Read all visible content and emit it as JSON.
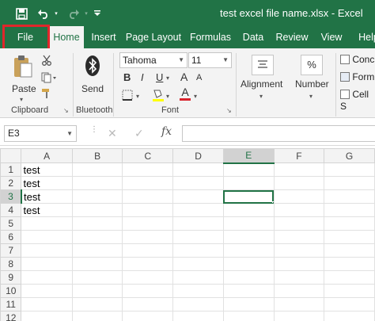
{
  "window": {
    "title": "test excel file name.xlsx  -  Excel"
  },
  "quick_access": {
    "save_icon": "save-icon",
    "undo_icon": "undo-icon",
    "redo_icon": "redo-icon",
    "customize_icon": "customize-qat-icon"
  },
  "tabs": [
    {
      "label": "File"
    },
    {
      "label": "Home"
    },
    {
      "label": "Insert"
    },
    {
      "label": "Page Layout"
    },
    {
      "label": "Formulas"
    },
    {
      "label": "Data"
    },
    {
      "label": "Review"
    },
    {
      "label": "View"
    },
    {
      "label": "Help"
    }
  ],
  "ribbon": {
    "clipboard": {
      "paste_label": "Paste",
      "group_label": "Clipboard"
    },
    "bluetooth": {
      "send_label": "Send",
      "group_label": "Bluetooth"
    },
    "font": {
      "font_name": "Tahoma",
      "font_size": "11",
      "bold": "B",
      "italic": "I",
      "underline": "U",
      "grow": "A",
      "shrink": "A",
      "font_color_letter": "A",
      "group_label": "Font"
    },
    "alignment": {
      "label": "Alignment"
    },
    "number": {
      "label": "Number",
      "percent": "%"
    },
    "styles": {
      "items": [
        "Conc",
        "Form",
        "Cell S"
      ]
    }
  },
  "formula_bar": {
    "name_box": "E3",
    "cancel": "✕",
    "enter": "✓",
    "fx": "fx",
    "content": ""
  },
  "grid": {
    "columns": [
      "A",
      "B",
      "C",
      "D",
      "E",
      "F",
      "G"
    ],
    "selected_column": "E",
    "selected_row": 3,
    "active_cell": "E3",
    "rows": [
      {
        "num": "1",
        "A": "test"
      },
      {
        "num": "2",
        "A": "test"
      },
      {
        "num": "3",
        "A": "test"
      },
      {
        "num": "4",
        "A": "test"
      },
      {
        "num": "5",
        "A": ""
      },
      {
        "num": "6",
        "A": ""
      },
      {
        "num": "7",
        "A": ""
      },
      {
        "num": "8",
        "A": ""
      },
      {
        "num": "9",
        "A": ""
      },
      {
        "num": "10",
        "A": ""
      },
      {
        "num": "11",
        "A": ""
      },
      {
        "num": "12",
        "A": ""
      }
    ]
  },
  "colors": {
    "excel_green": "#217346",
    "highlight_red": "#e0262b",
    "font_color_bar": "#d9232d",
    "fill_color_bar": "#ffff00"
  }
}
